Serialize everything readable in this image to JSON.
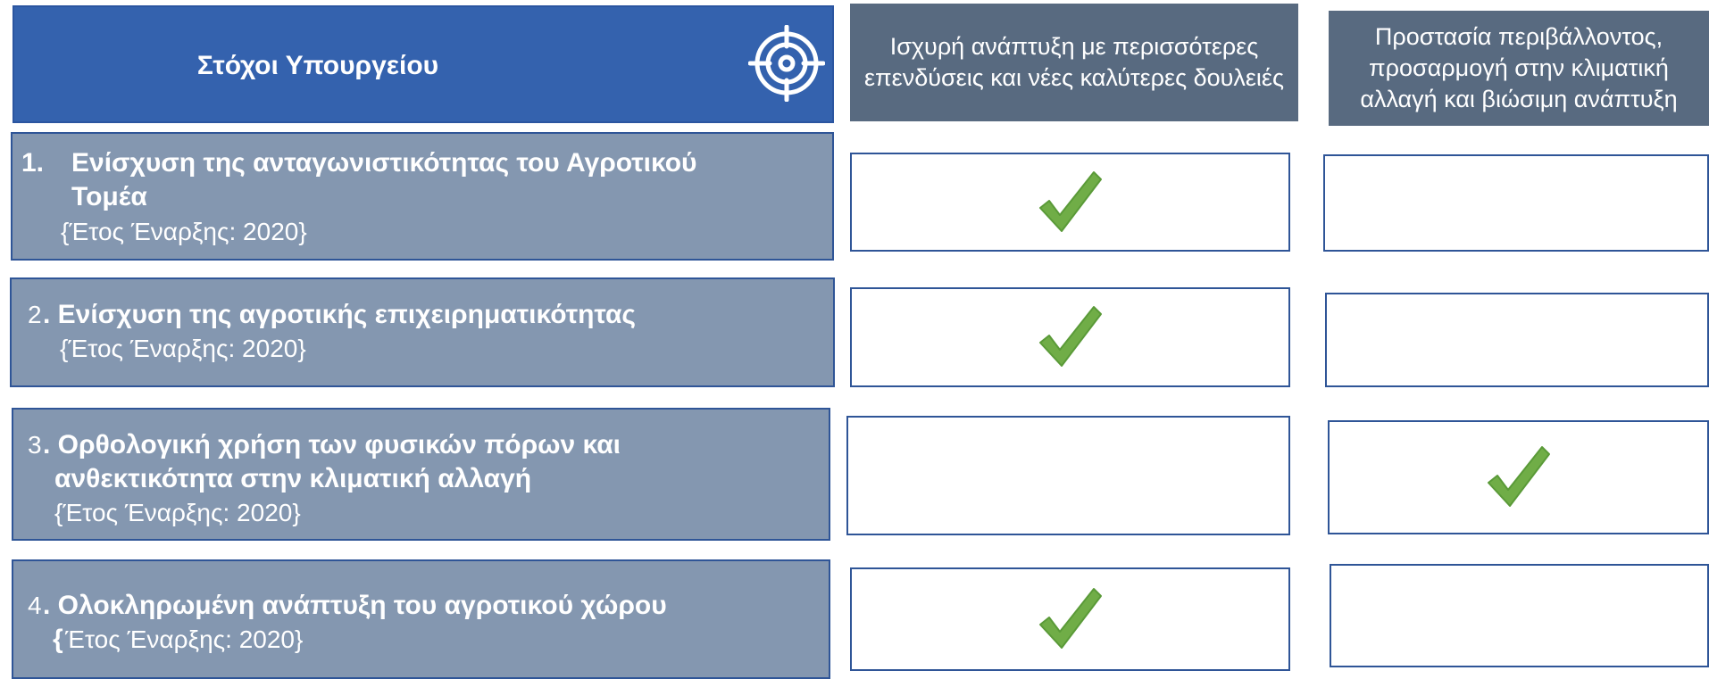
{
  "header": {
    "title": "Στόχοι Υπουργείου",
    "columns": [
      "Ισχυρή ανάπτυξη με περισσότερες επενδύσεις και νέες  καλύτερες δουλειές",
      "Προστασία περιβάλλοντος, προσαρμογή στην κλιματική αλλαγή και βιώσιμη ανάπτυξη"
    ]
  },
  "goals": [
    {
      "number": "1.",
      "title_line1": "Ενίσχυση της ανταγωνιστικότητας του Αγροτικού",
      "title_line2": "Τομέα",
      "start": "{Έτος Έναρξης: 2020}",
      "checks": [
        true,
        false
      ]
    },
    {
      "number": "2",
      "title_line1": ". Ενίσχυση της αγροτικής επιχειρηματικότητας",
      "start": "{Έτος Έναρξης: 2020}",
      "checks": [
        true,
        false
      ]
    },
    {
      "number": "3",
      "title_line1": ". Ορθολογική χρήση των φυσικών πόρων και",
      "title_line2": "ανθεκτικότητα στην κλιματική αλλαγή",
      "start": "{Έτος Έναρξης: 2020}",
      "checks": [
        false,
        true
      ]
    },
    {
      "number": "4",
      "title_line1": ". Ολοκληρωμένη ανάπτυξη του αγροτικού χώρου",
      "start_brace": "{",
      "start": "Έτος Έναρξης: 2020}",
      "checks": [
        true,
        false
      ]
    }
  ],
  "icons": {
    "header_icon": "target-icon",
    "check_icon": "check-icon"
  },
  "colors": {
    "header_blue": "#3462ae",
    "column_header": "#586a80",
    "goal_box": "#8497b0",
    "border": "#2f5597",
    "check_green": "#70ad47"
  }
}
